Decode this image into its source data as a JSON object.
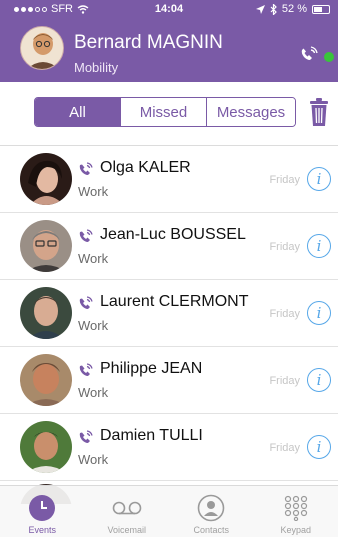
{
  "status_bar": {
    "carrier": "SFR",
    "time": "14:04",
    "battery": "52 %"
  },
  "header": {
    "user_name": "Bernard MAGNIN",
    "user_status": "Mobility",
    "online_color": "#39c43b"
  },
  "colors": {
    "accent": "#7a5aa6",
    "info": "#56a7e8"
  },
  "filter": {
    "tabs": [
      "All",
      "Missed",
      "Messages"
    ],
    "selected": "All"
  },
  "events": [
    {
      "name": "Olga KALER",
      "type": "Work",
      "date": "Friday",
      "icon": "phone-call-icon"
    },
    {
      "name": "Jean-Luc BOUSSEL",
      "type": "Work",
      "date": "Friday",
      "icon": "phone-call-icon"
    },
    {
      "name": "Laurent CLERMONT",
      "type": "Work",
      "date": "Friday",
      "icon": "phone-call-icon"
    },
    {
      "name": "Philippe JEAN",
      "type": "Work",
      "date": "Friday",
      "icon": "phone-call-icon"
    },
    {
      "name": "Damien TULLI",
      "type": "Work",
      "date": "Friday",
      "icon": "phone-call-icon"
    }
  ],
  "tabbar": {
    "items": [
      {
        "label": "Events",
        "icon": "clock-icon",
        "active": true
      },
      {
        "label": "Voicemail",
        "icon": "voicemail-icon",
        "active": false
      },
      {
        "label": "Contacts",
        "icon": "contact-icon",
        "active": false
      },
      {
        "label": "Keypad",
        "icon": "keypad-icon",
        "active": false
      }
    ]
  }
}
